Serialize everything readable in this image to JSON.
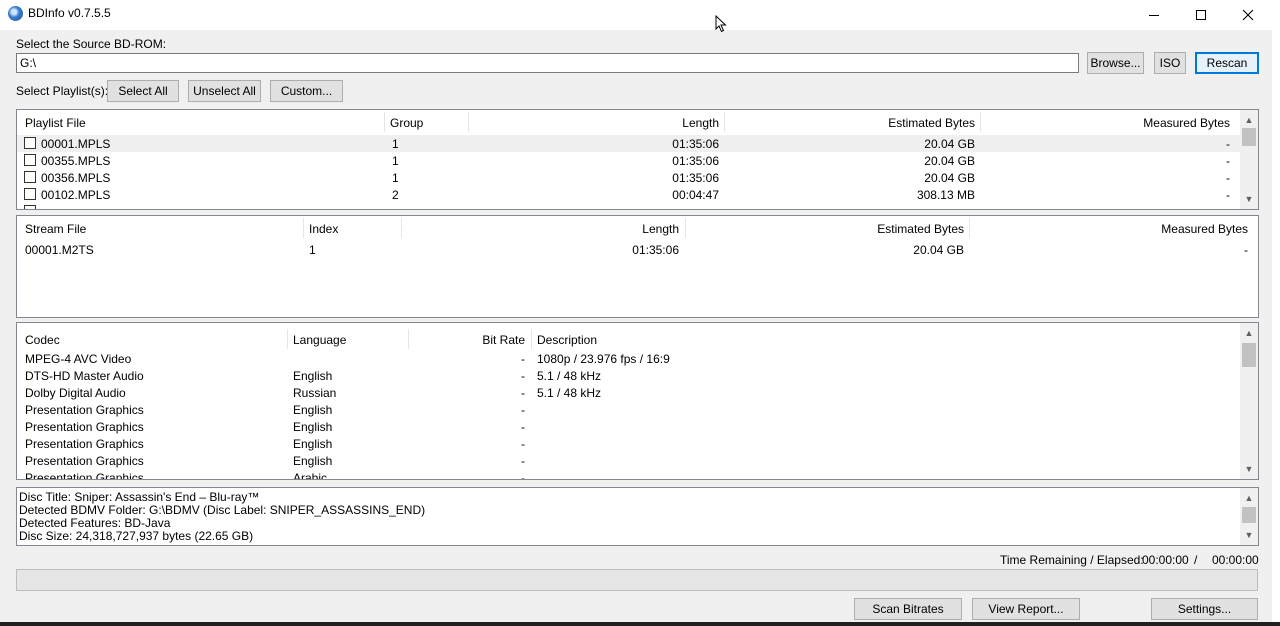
{
  "window": {
    "title": "BDInfo v0.7.5.5"
  },
  "source": {
    "label": "Select the Source BD-ROM:",
    "path": "G:\\",
    "browse_label": "Browse...",
    "iso_label": "ISO",
    "rescan_label": "Rescan"
  },
  "playlist_controls": {
    "label": "Select Playlist(s):",
    "select_all": "Select All",
    "unselect_all": "Unselect All",
    "custom": "Custom..."
  },
  "playlists": {
    "headers": [
      "Playlist File",
      "Group",
      "Length",
      "Estimated Bytes",
      "Measured Bytes"
    ],
    "rows": [
      {
        "file": "00001.MPLS",
        "group": "1",
        "length": "01:35:06",
        "est": "20.04 GB",
        "meas": "-"
      },
      {
        "file": "00355.MPLS",
        "group": "1",
        "length": "01:35:06",
        "est": "20.04 GB",
        "meas": "-"
      },
      {
        "file": "00356.MPLS",
        "group": "1",
        "length": "01:35:06",
        "est": "20.04 GB",
        "meas": "-"
      },
      {
        "file": "00102.MPLS",
        "group": "2",
        "length": "00:04:47",
        "est": "308.13 MB",
        "meas": "-"
      }
    ]
  },
  "streams": {
    "headers": [
      "Stream File",
      "Index",
      "Length",
      "Estimated Bytes",
      "Measured Bytes"
    ],
    "rows": [
      {
        "file": "00001.M2TS",
        "index": "1",
        "length": "01:35:06",
        "est": "20.04 GB",
        "meas": "-"
      }
    ]
  },
  "codecs": {
    "headers": [
      "Codec",
      "Language",
      "Bit Rate",
      "Description"
    ],
    "rows": [
      {
        "codec": "MPEG-4 AVC Video",
        "lang": "",
        "rate": "-",
        "desc": "1080p / 23.976 fps / 16:9"
      },
      {
        "codec": "DTS-HD Master Audio",
        "lang": "English",
        "rate": "-",
        "desc": "5.1 / 48 kHz"
      },
      {
        "codec": "Dolby Digital Audio",
        "lang": "Russian",
        "rate": "-",
        "desc": "5.1 / 48 kHz"
      },
      {
        "codec": "Presentation Graphics",
        "lang": "English",
        "rate": "-",
        "desc": ""
      },
      {
        "codec": "Presentation Graphics",
        "lang": "English",
        "rate": "-",
        "desc": ""
      },
      {
        "codec": "Presentation Graphics",
        "lang": "English",
        "rate": "-",
        "desc": ""
      },
      {
        "codec": "Presentation Graphics",
        "lang": "English",
        "rate": "-",
        "desc": ""
      },
      {
        "codec": "Presentation Graphics",
        "lang": "Arabic",
        "rate": "-",
        "desc": ""
      }
    ]
  },
  "info": {
    "lines": [
      "Disc Title: Sniper: Assassin's End – Blu-ray™",
      "Detected BDMV Folder: G:\\BDMV (Disc Label: SNIPER_ASSASSINS_END)",
      "Detected Features: BD-Java",
      "Disc Size: 24,318,727,937 bytes (22.65 GB)"
    ]
  },
  "timing": {
    "label": "Time Remaining / Elapsed:",
    "remaining": "00:00:00",
    "separator": "/",
    "elapsed": "00:00:00"
  },
  "progress": {
    "value": 0
  },
  "actions": {
    "scan_bitrates": "Scan Bitrates",
    "view_report": "View Report...",
    "settings": "Settings..."
  }
}
